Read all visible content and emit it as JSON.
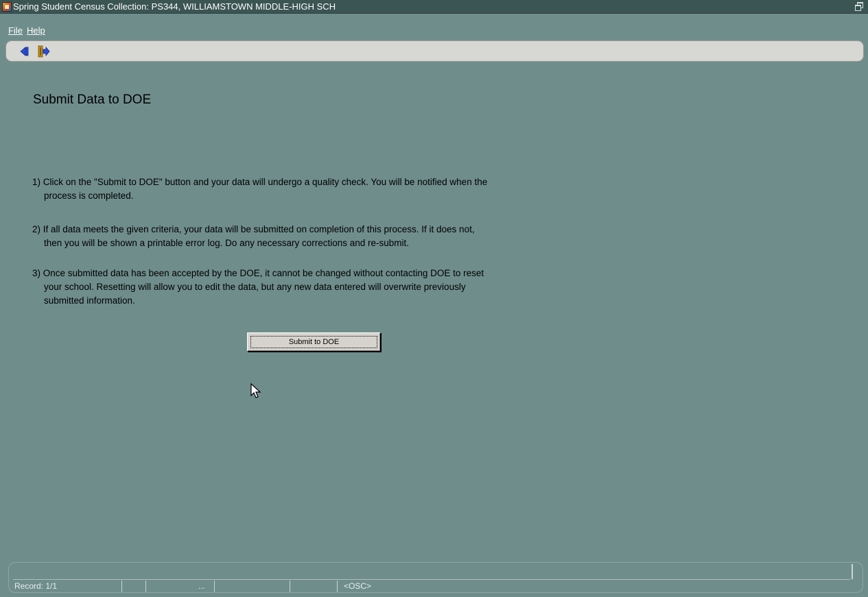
{
  "window": {
    "title": "Spring Student Census Collection: PS344, WILLIAMSTOWN MIDDLE-HIGH SCH",
    "icon": "app-icon",
    "restore_icon": "restore-icon"
  },
  "menu": {
    "file": "File",
    "help": "Help"
  },
  "toolbar": {
    "back_icon": "back-arrow-icon",
    "exit_icon": "exit-door-icon"
  },
  "main": {
    "page_title": "Submit Data to DOE",
    "instructions": [
      {
        "line1": "1) Click on the \"Submit to DOE\"  button and your data will undergo a quality check.   You will be notified when the",
        "line2": "process is completed."
      },
      {
        "line1": "2) If all data meets the given criteria, your data will be submitted on completion of this process.  If it  does not,",
        "line2": "then you will be shown a printable error log.  Do any necessary corrections and re-submit."
      },
      {
        "line1": "3) Once submitted data has been accepted by the DOE, it cannot be changed without contacting DOE to reset",
        "line2": "your school.  Resetting will allow you to edit the data, but any new data entered will overwrite previously",
        "line3": "submitted information."
      }
    ],
    "submit_button": "Submit to DOE"
  },
  "status": {
    "record": "Record: 1/1",
    "ellipsis": "...",
    "osc": "<OSC>"
  },
  "colors": {
    "background": "#6f8d8b",
    "titlebar": "#3b5553",
    "toolbar": "#d7d7d3",
    "accent_blue": "#2b4fd8"
  }
}
